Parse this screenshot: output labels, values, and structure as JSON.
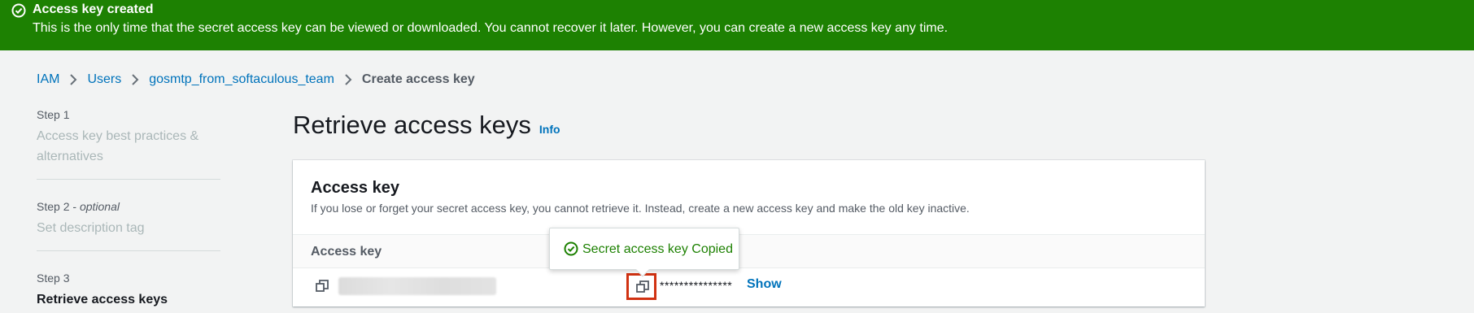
{
  "flash": {
    "icon": "check-circle-icon",
    "title": "Access key created",
    "message": "This is the only time that the secret access key can be viewed or downloaded. You cannot recover it later. However, you can create a new access key any time."
  },
  "breadcrumb": {
    "items": [
      "IAM",
      "Users",
      "gosmtp_from_softaculous_team"
    ],
    "current": "Create access key"
  },
  "steps": [
    {
      "number": "Step 1",
      "title": "Access key best practices & alternatives"
    },
    {
      "number": "Step 2",
      "optional": "optional",
      "title": "Set description tag"
    },
    {
      "number": "Step 3",
      "title": "Retrieve access keys"
    }
  ],
  "page": {
    "title": "Retrieve access keys",
    "info_link": "Info"
  },
  "card": {
    "title": "Access key",
    "description": "If you lose or forget your secret access key, you cannot retrieve it. Instead, create a new access key and make the old key inactive.",
    "column_header": "Access key",
    "secret_masked": "***************",
    "show_label": "Show"
  },
  "popover": {
    "icon": "check-circle-icon",
    "text": "Secret access key Copied"
  },
  "colors": {
    "success_green": "#1d8102",
    "link_blue": "#0073bb",
    "highlight_red": "#d13212"
  }
}
